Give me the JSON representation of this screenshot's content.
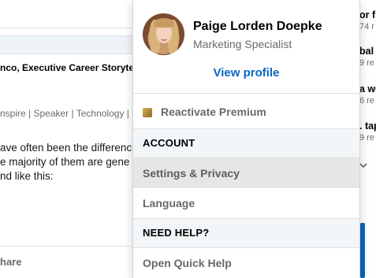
{
  "background": {
    "post_author": "nco, Executive Career Storyteller",
    "post_subtitle": "nspire | Speaker | Technology | H",
    "post_body": [
      "ave often been the differenc",
      "e majority of them are gene",
      "nd like this:"
    ],
    "share_label": "hare",
    "right_column": [
      {
        "title": "or f",
        "sub": "74 r"
      },
      {
        "title": "bal",
        "sub": "9 re"
      },
      {
        "title": "a we",
        "sub": "6 re"
      },
      {
        "title": ". tap",
        "sub": "9 re"
      }
    ]
  },
  "profile": {
    "name": "Paige Lorden Doepke",
    "headline": "Marketing Specialist",
    "view_profile_label": "View profile"
  },
  "premium": {
    "label": "Reactivate Premium",
    "icon": "premium-gold-icon",
    "icon_color": "#c9a04c"
  },
  "account": {
    "header": "ACCOUNT",
    "items": [
      {
        "label": "Settings & Privacy",
        "state": "hover"
      },
      {
        "label": "Language"
      }
    ]
  },
  "help": {
    "header": "NEED HELP?",
    "items": [
      {
        "label": "Open Quick Help"
      }
    ]
  },
  "colors": {
    "link_blue": "#0a66c2",
    "section_bg": "#f3f6f8",
    "hover_bg": "#e6e6e6"
  }
}
